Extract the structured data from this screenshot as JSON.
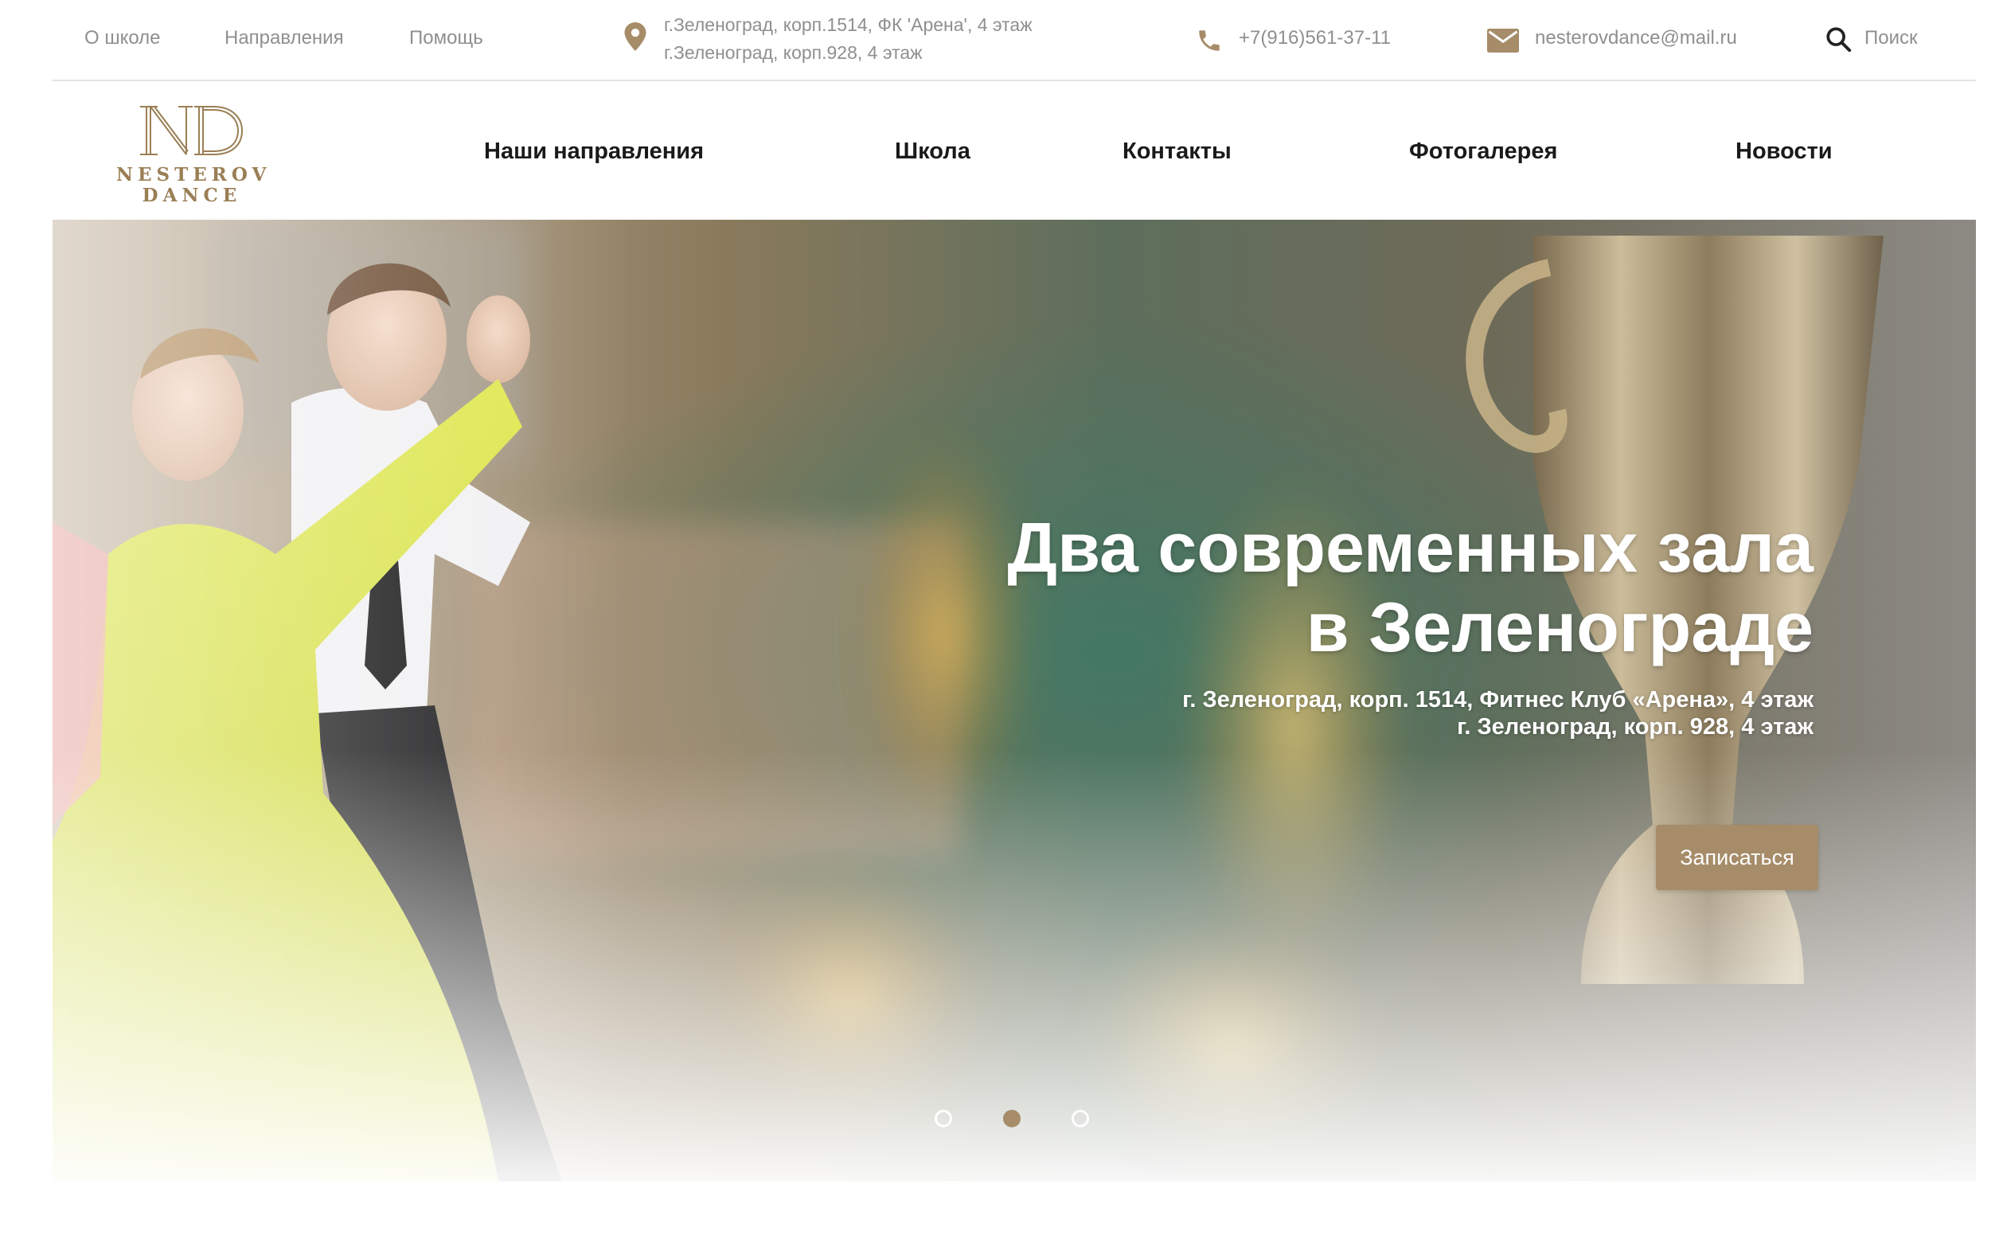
{
  "topbar": {
    "links": [
      {
        "label": "О школе"
      },
      {
        "label": "Направления"
      },
      {
        "label": "Помощь"
      }
    ],
    "address_lines": [
      "г.Зеленоград, корп.1514, ФК 'Арена', 4 этаж",
      "г.Зеленоград, корп.928, 4 этаж"
    ],
    "phone": "+7(916)561-37-11",
    "email": "nesterovdance@mail.ru",
    "search_label": "Поиск",
    "icons": {
      "address": "map-pin-icon",
      "phone": "phone-icon",
      "email": "envelope-icon",
      "search": "search-icon"
    }
  },
  "logo": {
    "monogram": "ND",
    "line1": "NESTEROV",
    "line2": "DANCE"
  },
  "nav": {
    "items": [
      {
        "label": "Наши направления"
      },
      {
        "label": "Школа"
      },
      {
        "label": "Контакты"
      },
      {
        "label": "Фотогалерея"
      },
      {
        "label": "Новости"
      }
    ]
  },
  "hero": {
    "title_lines": [
      "Два современных зала",
      "в Зеленограде"
    ],
    "subtitle_lines": [
      "г. Зеленоград, корп. 1514, Фитнес Клуб «Арена», 4 этаж",
      "г. Зеленоград, корп. 928, 4 этаж"
    ],
    "cta_label": "Записаться",
    "slides_total": 3,
    "active_slide": 2
  },
  "colors": {
    "accent": "#a68c69",
    "icon": "#a68c69",
    "muted_text": "#8f8f8f",
    "nav_text": "#1a1a1a"
  }
}
